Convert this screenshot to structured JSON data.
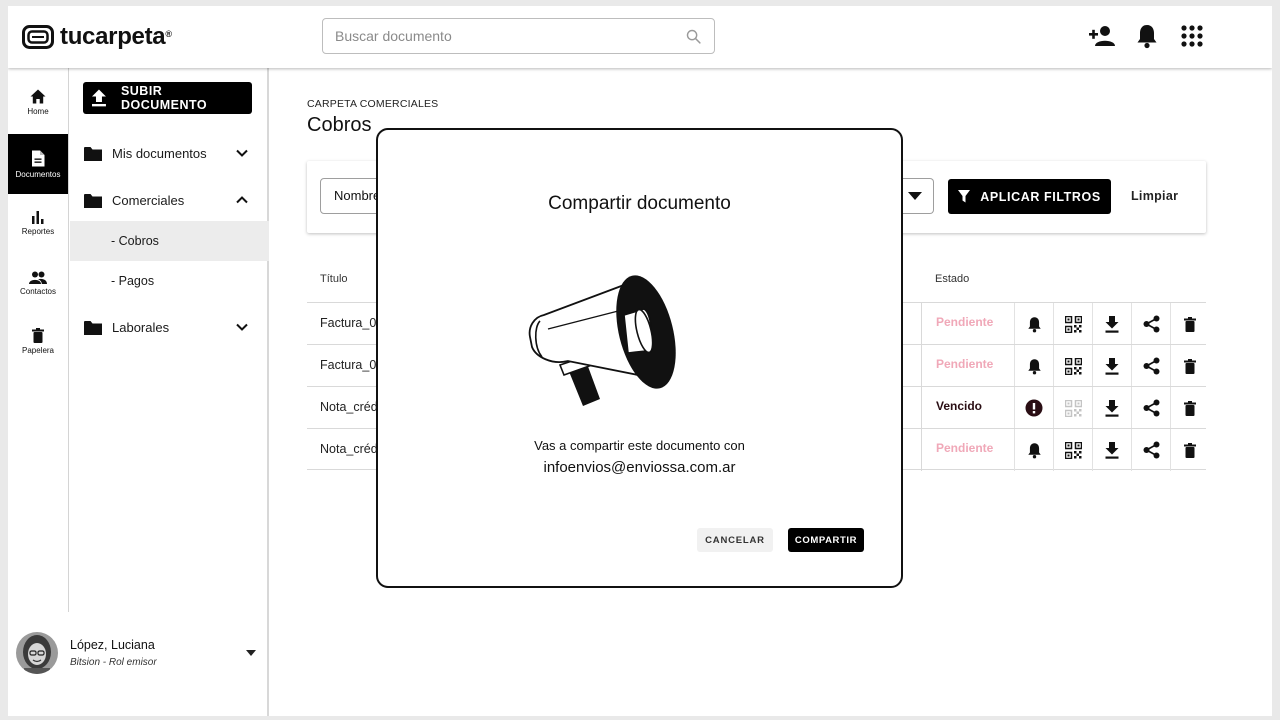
{
  "app": {
    "logo_text": "tucarpeta",
    "logo_mark": "®"
  },
  "search": {
    "placeholder": "Buscar documento",
    "value": ""
  },
  "topbar_icons": [
    "add-user-icon",
    "bell-icon",
    "apps-grid-icon"
  ],
  "rail": {
    "items": [
      {
        "label": "Home",
        "icon": "home-icon",
        "active": false
      },
      {
        "label": "Documentos",
        "icon": "document-icon",
        "active": true
      },
      {
        "label": "Reportes",
        "icon": "bar-chart-icon",
        "active": false
      },
      {
        "label": "Contactos",
        "icon": "people-icon",
        "active": false
      },
      {
        "label": "Papelera",
        "icon": "trash-icon",
        "active": false
      }
    ]
  },
  "panel": {
    "upload_label": "SUBIR DOCUMENTO",
    "folders": [
      {
        "label": "Mis documentos",
        "expanded": false
      },
      {
        "label": "Comerciales",
        "expanded": true
      },
      {
        "label": "Laborales",
        "expanded": false
      }
    ],
    "subfolders": [
      {
        "label": "- Cobros",
        "active": true
      },
      {
        "label": "- Pagos",
        "active": false
      }
    ]
  },
  "user": {
    "name": "López, Luciana",
    "role": "Bitsion - Rol emisor"
  },
  "main": {
    "breadcrumb": "CARPETA COMERCIALES",
    "title": "Cobros",
    "filters": {
      "name_value": "Nombre",
      "apply_label": "APLICAR FILTROS",
      "clear_label": "Limpiar"
    },
    "table": {
      "headers": {
        "title": "Título",
        "state": "Estado"
      },
      "rows": [
        {
          "title": "Factura_0",
          "state": "Pendiente",
          "alert": false
        },
        {
          "title": "Factura_0",
          "state": "Pendiente",
          "alert": false
        },
        {
          "title": "Nota_créd",
          "state": "Vencido",
          "alert": true
        },
        {
          "title": "Nota_créd",
          "state": "Pendiente",
          "alert": false
        }
      ]
    }
  },
  "modal": {
    "title": "Compartir documento",
    "message": "Vas a compartir este documento con",
    "email": "infoenvios@enviossa.com.ar",
    "cancel_label": "CANCELAR",
    "confirm_label": "COMPARTIR"
  },
  "colors": {
    "primary": "#000000",
    "pending": "#f0a8b8",
    "expired": "#2a0e14",
    "active_subfolder": "#ececec"
  }
}
